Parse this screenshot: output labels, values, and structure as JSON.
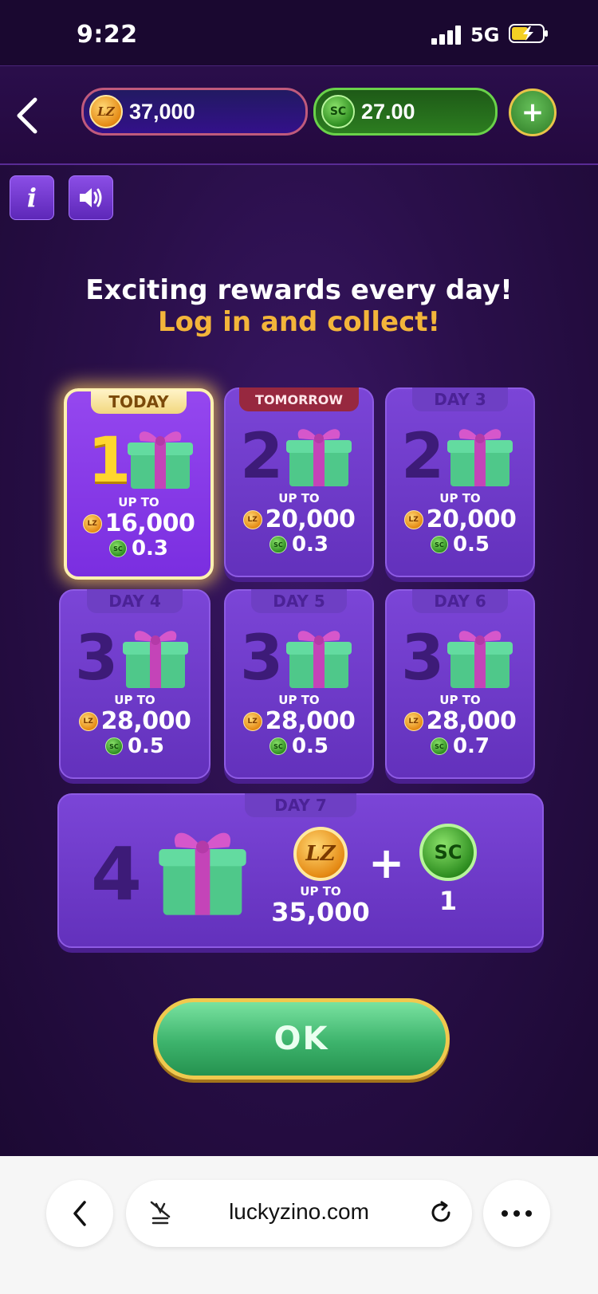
{
  "status": {
    "time": "9:22",
    "network": "5G"
  },
  "header": {
    "coins_balance": "37,000",
    "sc_balance": "27.00",
    "coin_badge": "LZ",
    "sc_badge": "SC",
    "add_label": "+"
  },
  "headline": {
    "line1": "Exciting rewards every day!",
    "line2": "Log in and collect!"
  },
  "days": [
    {
      "tab": "TODAY",
      "num": "1",
      "upto": "UP TO",
      "coins": "16,000",
      "sc": "0.3"
    },
    {
      "tab": "TOMORROW",
      "num": "2",
      "upto": "UP TO",
      "coins": "20,000",
      "sc": "0.3"
    },
    {
      "tab": "DAY 3",
      "num": "2",
      "upto": "UP TO",
      "coins": "20,000",
      "sc": "0.5"
    },
    {
      "tab": "DAY 4",
      "num": "3",
      "upto": "UP TO",
      "coins": "28,000",
      "sc": "0.5"
    },
    {
      "tab": "DAY 5",
      "num": "3",
      "upto": "UP TO",
      "coins": "28,000",
      "sc": "0.5"
    },
    {
      "tab": "DAY 6",
      "num": "3",
      "upto": "UP TO",
      "coins": "28,000",
      "sc": "0.7"
    }
  ],
  "day7": {
    "tab": "DAY 7",
    "num": "4",
    "upto": "UP TO",
    "coins": "35,000",
    "plus": "+",
    "sc": "1",
    "coin_badge": "LZ",
    "sc_badge": "SC"
  },
  "ok_label": "OK",
  "browser": {
    "domain": "luckyzino.com"
  },
  "colors": {
    "accent_gold": "#f3b53a",
    "card_purple": "#6f3bc9",
    "ok_green": "#3db36c"
  }
}
